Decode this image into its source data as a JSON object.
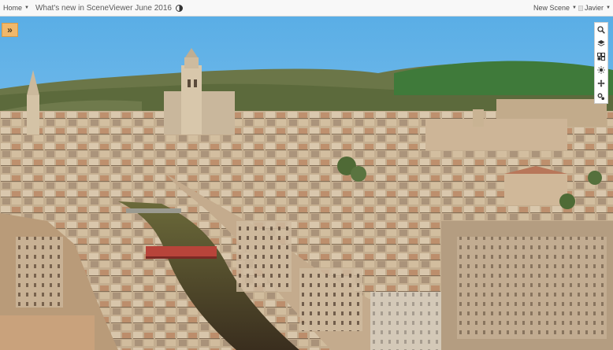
{
  "header": {
    "home_label": "Home",
    "title": "What's new in SceneViewer June 2016",
    "new_scene_label": "New Scene",
    "user_name": "Javier"
  },
  "scene": {
    "description_icons": [
      "search-icon",
      "layers-icon",
      "basemap-gallery-icon",
      "daylight-icon",
      "navigate-icon",
      "settings-icon"
    ]
  },
  "colors": {
    "header_bg": "#f8f8f8",
    "expand_button": "#f2b86a",
    "sky": "#6fb6e6"
  }
}
